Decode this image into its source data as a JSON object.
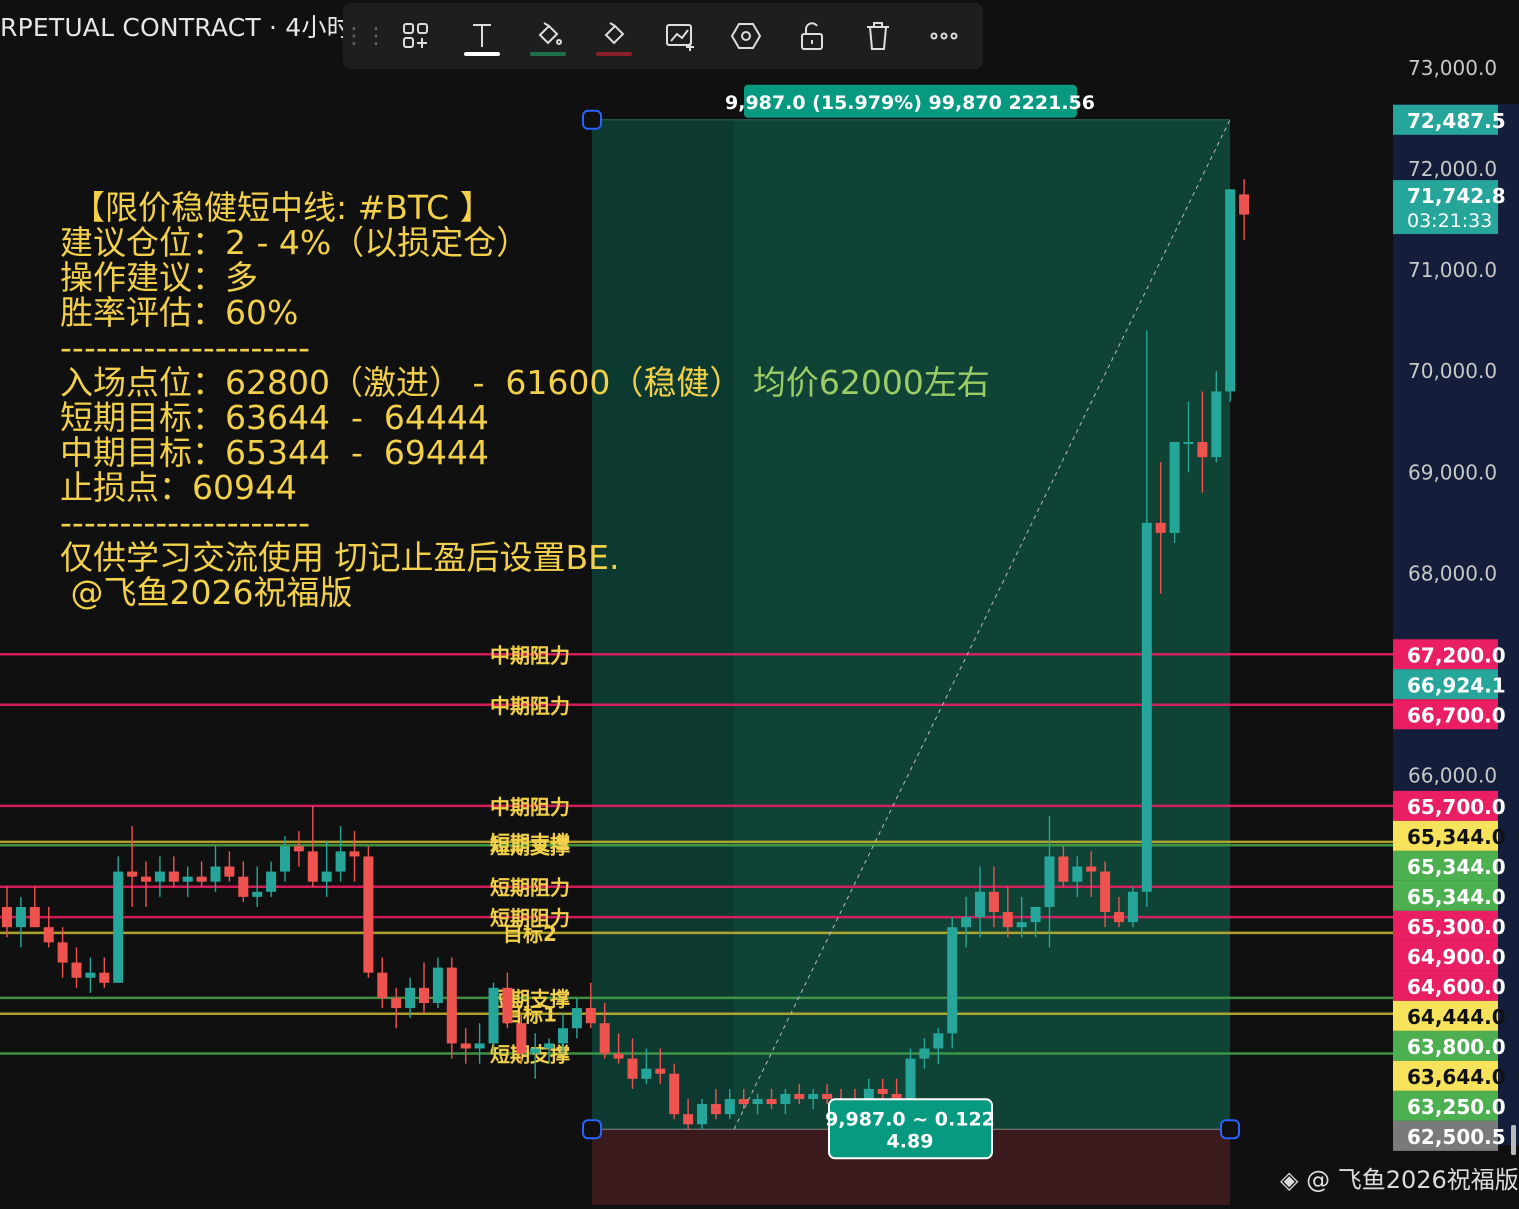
{
  "header": {
    "title": "RPETUAL CONTRACT · 4小时"
  },
  "toolbar": {
    "items": [
      {
        "icon": "drag-handle-icon"
      },
      {
        "icon": "template-grid-icon"
      },
      {
        "icon": "text-icon"
      },
      {
        "icon": "fill-color-icon"
      },
      {
        "icon": "line-color-icon"
      },
      {
        "icon": "chart-settings-icon"
      },
      {
        "icon": "hexagon-settings-icon"
      },
      {
        "icon": "unlock-icon"
      },
      {
        "icon": "trash-icon"
      },
      {
        "icon": "more-icon"
      }
    ],
    "fill_underline_color": "#26a69a",
    "line_underline_color": "#ef5350"
  },
  "note": {
    "line1": "【限价稳健短中线: #BTC 】",
    "line2": "建议仓位：2 - 4%（以损定仓）",
    "line3": "操作建议：多",
    "line4": "胜率评估：60%",
    "sep1": "---------------------",
    "line5a": "入场点位：62800（激进） -  61600（稳健）",
    "line5b": " 均价62000左右",
    "line6": "短期目标：63644  -  64444",
    "line7": "中期目标：65344  -  69444",
    "line8": "止损点：60944",
    "sep2": "---------------------",
    "line9": "仅供学习交流使用 切记止盈后设置BE.",
    "line10": " @飞鱼2026祝福版"
  },
  "position_tool": {
    "top_label": "9,987.0 (15.979%) 99,870 2221.56",
    "bottom_label_line1": "9,987.0 ~ 0.122",
    "bottom_label_line2": "4.89",
    "entry": 62500.5,
    "target": 72487.5
  },
  "watermark": "◈ @ 飞鱼2026祝福版",
  "colors": {
    "up": "#26a69a",
    "down": "#ef5350",
    "resistance": "#e91e63",
    "support_green": "#43a047",
    "target_yellow": "#c0b030",
    "zone_profit": "#0e3d33",
    "zone_loss": "#3a1a1c",
    "axis_bg": "#141d3a"
  },
  "chart_data": {
    "type": "candlestick",
    "title": "",
    "interval": "4小时",
    "y_axis": {
      "ticks": [
        "73,000.0",
        "72,000.0",
        "71,000.0",
        "70,000.0",
        "69,000.0",
        "68,000.0",
        "66,000.0"
      ],
      "range": [
        61500,
        73500
      ]
    },
    "price_labels": [
      {
        "text": "72,487.5",
        "value": 72487.5,
        "color": "#26a69a"
      },
      {
        "text": "71,742.8",
        "sub": "03:21:33",
        "value": 71742.8,
        "color": "#26a69a"
      },
      {
        "text": "67,200.0",
        "value": 67200.0,
        "color": "#e91e63"
      },
      {
        "text": "66,924.1",
        "value": 66924.1,
        "color": "#26a69a"
      },
      {
        "text": "66,700.0",
        "value": 66700.0,
        "color": "#e91e63"
      },
      {
        "text": "65,700.0",
        "value": 65700.0,
        "color": "#e91e63"
      },
      {
        "text": "65,344.0",
        "value": 65344.0,
        "color": "#f7e35b",
        "dark": true
      },
      {
        "text": "65,344.0",
        "value": 65344.0,
        "color": "#4caf50"
      },
      {
        "text": "65,344.0",
        "value": 65344.0,
        "color": "#4caf50"
      },
      {
        "text": "65,300.0",
        "value": 65300.0,
        "color": "#e91e63"
      },
      {
        "text": "64,900.0",
        "value": 64900.0,
        "color": "#e91e63"
      },
      {
        "text": "64,600.0",
        "value": 64600.0,
        "color": "#e91e63"
      },
      {
        "text": "64,444.0",
        "value": 64444.0,
        "color": "#f7e35b",
        "dark": true
      },
      {
        "text": "63,800.0",
        "value": 63800.0,
        "color": "#4caf50"
      },
      {
        "text": "63,644.0",
        "value": 63644.0,
        "color": "#f7e35b",
        "dark": true
      },
      {
        "text": "63,250.0",
        "value": 63250.0,
        "color": "#4caf50"
      },
      {
        "text": "62,500.5",
        "value": 62500.5,
        "color": "#7a7a7a"
      }
    ],
    "levels": [
      {
        "label": "中期阻力",
        "value": 67200,
        "color": "#e91e63"
      },
      {
        "label": "中期阻力",
        "value": 66700,
        "color": "#e91e63"
      },
      {
        "label": "中期阻力",
        "value": 65700,
        "color": "#e91e63"
      },
      {
        "label": "短期支撑",
        "value": 65344,
        "color": "#c0b030"
      },
      {
        "label": "短期支撑",
        "value": 65310,
        "color": "#43a047"
      },
      {
        "label": "短期阻力",
        "value": 64900,
        "color": "#e91e63"
      },
      {
        "label": "短期阻力",
        "value": 64600,
        "color": "#e91e63"
      },
      {
        "label": "目标2",
        "value": 64444,
        "color": "#c0b030"
      },
      {
        "label": "短期支撑",
        "value": 63800,
        "color": "#43a047"
      },
      {
        "label": "目标1",
        "value": 63644,
        "color": "#c0b030"
      },
      {
        "label": "短期支撑",
        "value": 63250,
        "color": "#43a047"
      }
    ],
    "candles": [
      [
        64700,
        64900,
        64400,
        64500
      ],
      [
        64500,
        64800,
        64300,
        64700
      ],
      [
        64700,
        64900,
        64500,
        64500
      ],
      [
        64500,
        64700,
        64300,
        64350
      ],
      [
        64350,
        64500,
        64000,
        64150
      ],
      [
        64150,
        64300,
        63900,
        64000
      ],
      [
        64000,
        64200,
        63850,
        64050
      ],
      [
        64050,
        64200,
        63900,
        63950
      ],
      [
        63950,
        65200,
        63950,
        65050
      ],
      [
        65050,
        65500,
        64700,
        65000
      ],
      [
        65000,
        65150,
        64700,
        64950
      ],
      [
        64950,
        65200,
        64800,
        65050
      ],
      [
        65050,
        65200,
        64900,
        64950
      ],
      [
        64950,
        65100,
        64800,
        65000
      ],
      [
        65000,
        65150,
        64900,
        64950
      ],
      [
        64950,
        65300,
        64850,
        65100
      ],
      [
        65100,
        65250,
        64950,
        65000
      ],
      [
        65000,
        65150,
        64750,
        64800
      ],
      [
        64800,
        65100,
        64700,
        64850
      ],
      [
        64850,
        65150,
        64800,
        65050
      ],
      [
        65050,
        65400,
        64950,
        65300
      ],
      [
        65300,
        65450,
        65100,
        65250
      ],
      [
        65250,
        65700,
        64900,
        64950
      ],
      [
        64950,
        65350,
        64800,
        65050
      ],
      [
        65050,
        65500,
        64950,
        65250
      ],
      [
        65250,
        65450,
        64950,
        65200
      ],
      [
        65200,
        65300,
        64000,
        64050
      ],
      [
        64050,
        64200,
        63700,
        63800
      ],
      [
        63800,
        63900,
        63500,
        63700
      ],
      [
        63700,
        64000,
        63600,
        63900
      ],
      [
        63900,
        64150,
        63650,
        63750
      ],
      [
        63750,
        64200,
        63700,
        64100
      ],
      [
        64100,
        64200,
        63200,
        63350
      ],
      [
        63350,
        63500,
        63150,
        63300
      ],
      [
        63300,
        63550,
        63150,
        63350
      ],
      [
        63350,
        63950,
        63250,
        63900
      ],
      [
        63900,
        64050,
        63500,
        63550
      ],
      [
        63550,
        63650,
        63150,
        63250
      ],
      [
        63250,
        63450,
        63000,
        63300
      ],
      [
        63300,
        63400,
        63150,
        63350
      ],
      [
        63350,
        63650,
        63250,
        63500
      ],
      [
        63500,
        63800,
        63400,
        63700
      ],
      [
        63700,
        63950,
        63500,
        63550
      ],
      [
        63550,
        63750,
        63200,
        63250
      ],
      [
        63250,
        63450,
        63150,
        63200
      ],
      [
        63200,
        63400,
        62900,
        63000
      ],
      [
        63000,
        63300,
        62950,
        63100
      ],
      [
        63100,
        63300,
        62950,
        63050
      ],
      [
        63050,
        63150,
        62600,
        62650
      ],
      [
        62650,
        62800,
        62500,
        62550
      ],
      [
        62550,
        62800,
        62500,
        62750
      ],
      [
        62750,
        62900,
        62600,
        62650
      ],
      [
        62650,
        62900,
        62600,
        62800
      ],
      [
        62800,
        62900,
        62700,
        62750
      ],
      [
        62750,
        62850,
        62650,
        62800
      ],
      [
        62800,
        62900,
        62700,
        62750
      ],
      [
        62750,
        62900,
        62650,
        62850
      ],
      [
        62850,
        62950,
        62750,
        62800
      ],
      [
        62800,
        62900,
        62700,
        62850
      ],
      [
        62850,
        62950,
        62750,
        62800
      ],
      [
        62800,
        62900,
        62700,
        62750
      ],
      [
        62750,
        62900,
        62650,
        62700
      ],
      [
        62700,
        63000,
        62650,
        62900
      ],
      [
        62900,
        63000,
        62700,
        62850
      ],
      [
        62850,
        63000,
        62600,
        62650
      ],
      [
        62650,
        63300,
        62600,
        63200
      ],
      [
        63200,
        63400,
        63100,
        63300
      ],
      [
        63300,
        63500,
        63150,
        63450
      ],
      [
        63450,
        64600,
        63300,
        64500
      ],
      [
        64500,
        64800,
        64300,
        64600
      ],
      [
        64600,
        65100,
        64400,
        64850
      ],
      [
        64850,
        65100,
        64500,
        64650
      ],
      [
        64650,
        64900,
        64400,
        64500
      ],
      [
        64500,
        64800,
        64400,
        64550
      ],
      [
        64550,
        64700,
        64400,
        64700
      ],
      [
        64700,
        65600,
        64300,
        65200
      ],
      [
        65200,
        65300,
        64900,
        64950
      ],
      [
        64950,
        65200,
        64800,
        65100
      ],
      [
        65100,
        65250,
        64800,
        65050
      ],
      [
        65050,
        65150,
        64500,
        64650
      ],
      [
        64650,
        64800,
        64500,
        64550
      ],
      [
        64550,
        64900,
        64500,
        64850
      ],
      [
        64850,
        70400,
        64700,
        68500
      ],
      [
        68500,
        69100,
        67800,
        68400
      ],
      [
        68400,
        69300,
        68300,
        69300
      ],
      [
        69300,
        69700,
        69000,
        69300
      ],
      [
        69300,
        69800,
        68800,
        69150
      ],
      [
        69150,
        70000,
        69100,
        69800
      ],
      [
        69800,
        71800,
        69700,
        71800
      ],
      [
        71750,
        71900,
        71300,
        71550
      ]
    ]
  }
}
